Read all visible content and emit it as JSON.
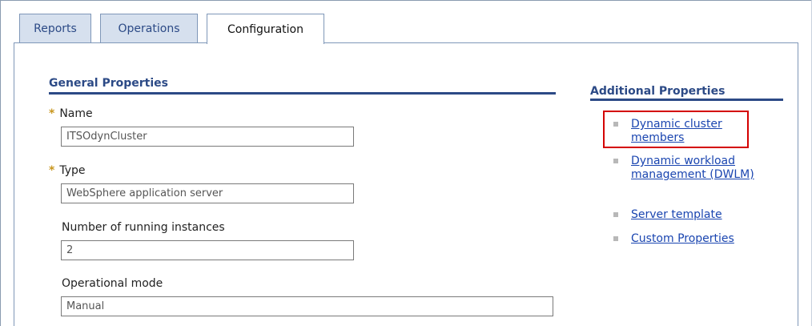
{
  "tabs": [
    {
      "label": "Reports",
      "active": false
    },
    {
      "label": "Operations",
      "active": false
    },
    {
      "label": "Configuration",
      "active": true
    }
  ],
  "general": {
    "title": "General Properties",
    "fields": [
      {
        "label": "Name",
        "required": true,
        "value": "ITSOdynCluster"
      },
      {
        "label": "Type",
        "required": true,
        "value": "WebSphere application server"
      },
      {
        "label": "Number of running instances",
        "required": false,
        "value": "2"
      },
      {
        "label": "Operational mode",
        "required": false,
        "value": "Manual"
      }
    ],
    "required_marker": "*"
  },
  "additional": {
    "title": "Additional Properties",
    "links": [
      {
        "label": "Dynamic cluster members",
        "highlighted": true
      },
      {
        "label": "Dynamic workload management (DWLM)",
        "highlighted": false
      },
      {
        "label": "Server template",
        "highlighted": false
      },
      {
        "label": "Custom Properties",
        "highlighted": false
      }
    ]
  },
  "colors": {
    "accent": "#2c4a86",
    "link": "#1a45b0",
    "required": "#c8961e",
    "highlight": "#d40000",
    "tab_inactive_bg": "#d6e0ee"
  }
}
